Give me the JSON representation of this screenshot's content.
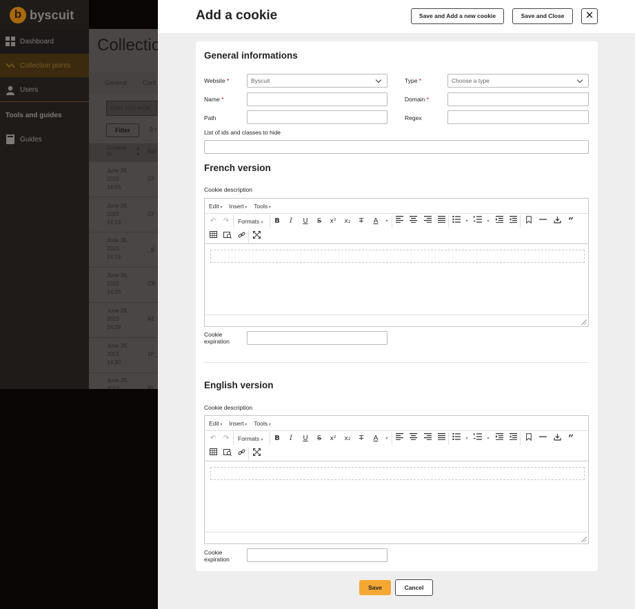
{
  "app": {
    "logo_letter": "b",
    "logo_text": "byscuit"
  },
  "sidebar": {
    "items": [
      {
        "label": "Dashboard",
        "icon": "dashboard-grid-icon"
      },
      {
        "label": "Collection points",
        "icon": "collection-points-icon"
      },
      {
        "label": "Users",
        "icon": "user-icon"
      }
    ],
    "section_title": "Tools and guides",
    "tools": [
      {
        "label": "Guides",
        "icon": "book-icon"
      }
    ]
  },
  "background_page": {
    "title": "Collectio",
    "tabs": [
      "General",
      "Cont"
    ],
    "search_placeholder": "Enter your keyw",
    "filter_label": "Filter",
    "result_count": "9 r",
    "columns": [
      "Created At",
      "Nar"
    ],
    "rows": [
      {
        "date": "June 29, 2023 14:06",
        "code": "CF"
      },
      {
        "date": "June 29, 2023 14:13",
        "code": "CF"
      },
      {
        "date": "June 29, 2023 14:19",
        "code": "_gi"
      },
      {
        "date": "June 29, 2023 14:25",
        "code": "CB"
      },
      {
        "date": "June 29, 2023 14:29",
        "code": "AE"
      },
      {
        "date": "June 29, 2023 14:30",
        "code": "1P_"
      },
      {
        "date": "June 29, 2023",
        "code": "NI"
      }
    ]
  },
  "drawer": {
    "title": "Add a cookie",
    "save_new_label": "Save and Add a new cookie",
    "save_close_label": "Save and Close",
    "close_symbol": "✕"
  },
  "form": {
    "general_heading": "General informations",
    "website": {
      "label": "Website",
      "value": "Byscuit"
    },
    "type": {
      "label": "Type",
      "placeholder": "Choose a type"
    },
    "name": {
      "label": "Name",
      "value": ""
    },
    "domain": {
      "label": "Domain",
      "value": ""
    },
    "path": {
      "label": "Path",
      "value": ""
    },
    "regex": {
      "label": "Regex",
      "value": ""
    },
    "hide_list": {
      "label": "List of ids and classes to hide",
      "value": ""
    },
    "required_mark": "*",
    "french": {
      "heading": "French version",
      "desc_label": "Cookie description",
      "expiration_label": "Cookie expiration"
    },
    "english": {
      "heading": "English version",
      "desc_label": "Cookie description",
      "expiration_label": "Cookie expiration"
    }
  },
  "editor": {
    "menus": [
      "Edit",
      "Insert",
      "Tools"
    ],
    "formats_label": "Formats",
    "glyphs": {
      "bold": "B",
      "italic": "I",
      "underline": "U",
      "strike": "S"
    }
  },
  "footer": {
    "save_label": "Save",
    "cancel_label": "Cancel"
  },
  "colors": {
    "accent": "#f5a733",
    "required": "#cc0000",
    "drawer_bg": "#eeeeee"
  }
}
